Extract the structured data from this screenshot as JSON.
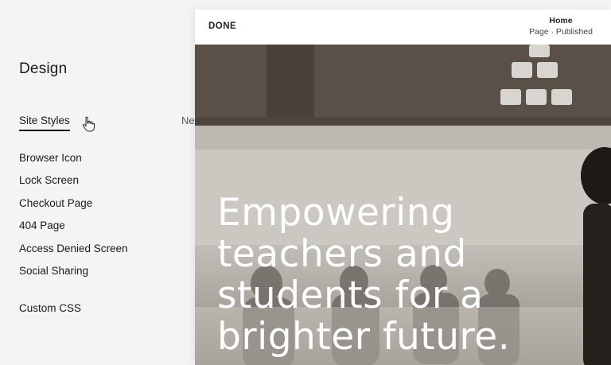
{
  "panel": {
    "title": "Design",
    "active_item": "Site Styles",
    "items": [
      "Browser Icon",
      "Lock Screen",
      "Checkout Page",
      "404 Page",
      "Access Denied Screen",
      "Social Sharing"
    ],
    "custom_css": "Custom CSS",
    "peek_text": "Ne"
  },
  "preview": {
    "done_label": "DONE",
    "page_name": "Home",
    "page_status": "Page · Published",
    "headline": [
      "Empowering",
      "teachers and",
      "students for a",
      "brighter future."
    ]
  }
}
